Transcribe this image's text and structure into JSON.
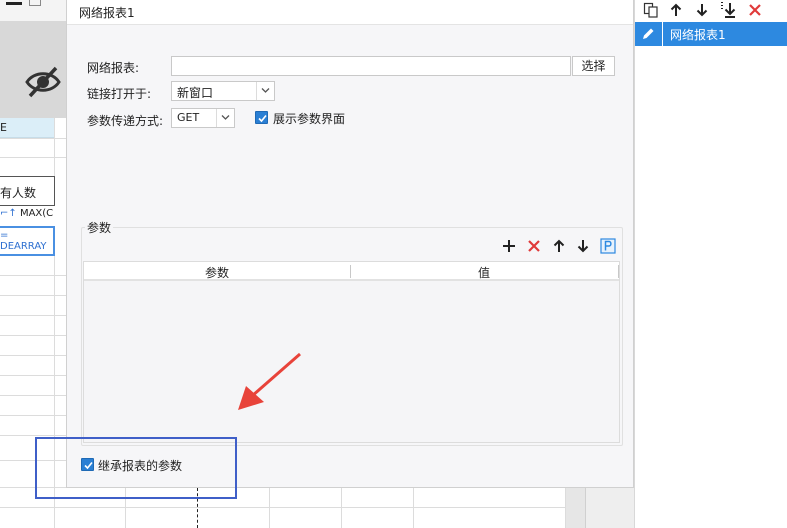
{
  "dialog": {
    "title": "网络报表1",
    "report_label": "网络报表:",
    "report_value": "",
    "select_button": "选择",
    "open_in_label": "链接打开于:",
    "open_in_value": "新窗口",
    "method_label": "参数传递方式:",
    "method_value": "GET",
    "show_params_label": "展示参数界面",
    "show_params_checked": true,
    "params_group_title": "参数",
    "params_table": {
      "columns": [
        "参数",
        "值"
      ],
      "rows": []
    },
    "inherit_label": "继承报表的参数",
    "inherit_checked": true
  },
  "right_panel": {
    "items": [
      {
        "label": "网络报表1",
        "selected": true
      }
    ]
  },
  "sheet": {
    "header_cell": "E",
    "cell_count_label": "有人数",
    "cell_formula_max": "MAX(C",
    "cell_formula_eq": "=",
    "cell_formula_arr": "DEARRAY"
  },
  "colors": {
    "accent": "#2d89e0",
    "delete_red": "#e03a3a",
    "annotation_arrow": "#e8433a",
    "annotation_box": "#3f5fc8"
  }
}
